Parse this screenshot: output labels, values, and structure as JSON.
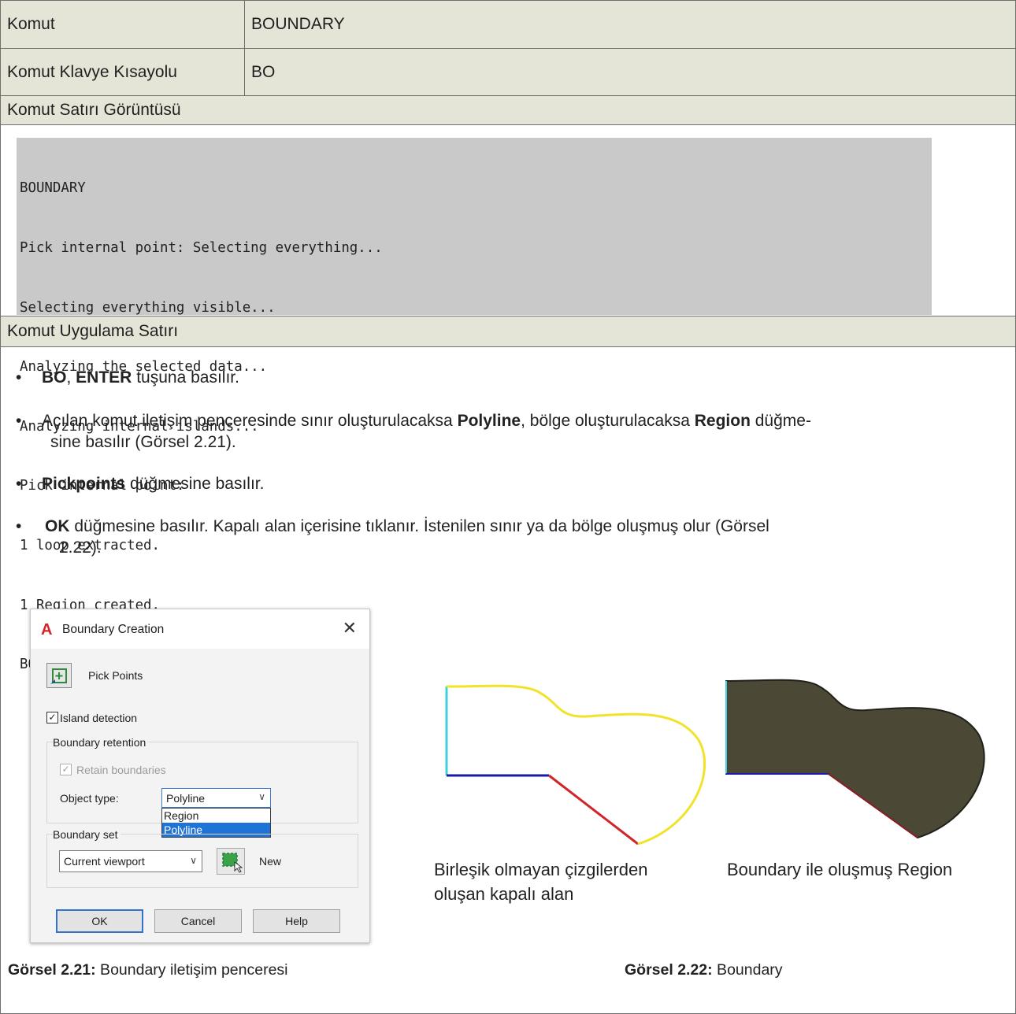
{
  "table": {
    "row1": {
      "label": "Komut",
      "value": "BOUNDARY"
    },
    "row2": {
      "label": "Komut Klavye Kısayolu",
      "value": "BO"
    },
    "row3": {
      "label": "Komut Satırı Görüntüsü"
    },
    "row4": {
      "label": "Komut Uygulama Satırı"
    }
  },
  "console_lines": [
    "BOUNDARY",
    "Pick internal point: Selecting everything...",
    "Selecting everything visible...",
    "Analyzing the selected data...",
    "Analyzing internal islands...",
    "Pick internal point:",
    "1 loop extracted.",
    "1 Region created.",
    "BOUNDARY created 1 region"
  ],
  "bullets": {
    "b1": {
      "bold1": "BO",
      "sep": ", ",
      "bold2": "ENTER",
      "rest": " tuşuna basılır."
    },
    "b2": {
      "t1": "Açılan komut iletişim penceresinde sınır oluşturulacaksa ",
      "bold1": "Polyline",
      "t2": ", bölge oluşturulacaksa ",
      "bold2": "Region",
      "t3": " düğme-",
      "line2": "sine basılır (Görsel 2.21)."
    },
    "b3": {
      "bold1": "Pickpoints",
      "rest": " düğmesine basılır."
    },
    "b4": {
      "bold1": "OK",
      "line1": " düğmesine basılır. Kapalı alan içerisine tıklanır. İstenilen sınır ya da bölge oluşmuş olur (Görsel",
      "line2": "2.22)."
    }
  },
  "bullet_glyph": "•",
  "dialog": {
    "logo": "A",
    "title": "Boundary Creation",
    "close": "✕",
    "pick_points": "Pick Points",
    "island_detection": "Island detection",
    "check_mark": "✓",
    "boundary_retention": "Boundary retention",
    "retain_boundaries": "Retain boundaries",
    "object_type_label": "Object type:",
    "object_type_value": "Polyline",
    "object_type_options": [
      "Region",
      "Polyline"
    ],
    "boundary_set": "Boundary set",
    "boundary_set_value": "Current viewport",
    "new_label": "New",
    "ok": "OK",
    "cancel": "Cancel",
    "help": "Help"
  },
  "figures": {
    "left_caption_line1": "Birleşik olmayan çizgilerden",
    "left_caption_line2": "oluşan kapalı alan",
    "right_caption": "Boundary ile oluşmuş Region",
    "colors": {
      "curve": "#f0e32a",
      "left_edge": "#3fd0e0",
      "bottom_edge": "#1a1aa8",
      "diagonal": "#d0262b",
      "region_fill": "#4b4836"
    }
  },
  "figure_captions": {
    "fig1_label": "Görsel 2.21:",
    "fig1_text": " Boundary iletişim penceresi",
    "fig2_label": "Görsel 2.22:",
    "fig2_text": " Boundary"
  }
}
